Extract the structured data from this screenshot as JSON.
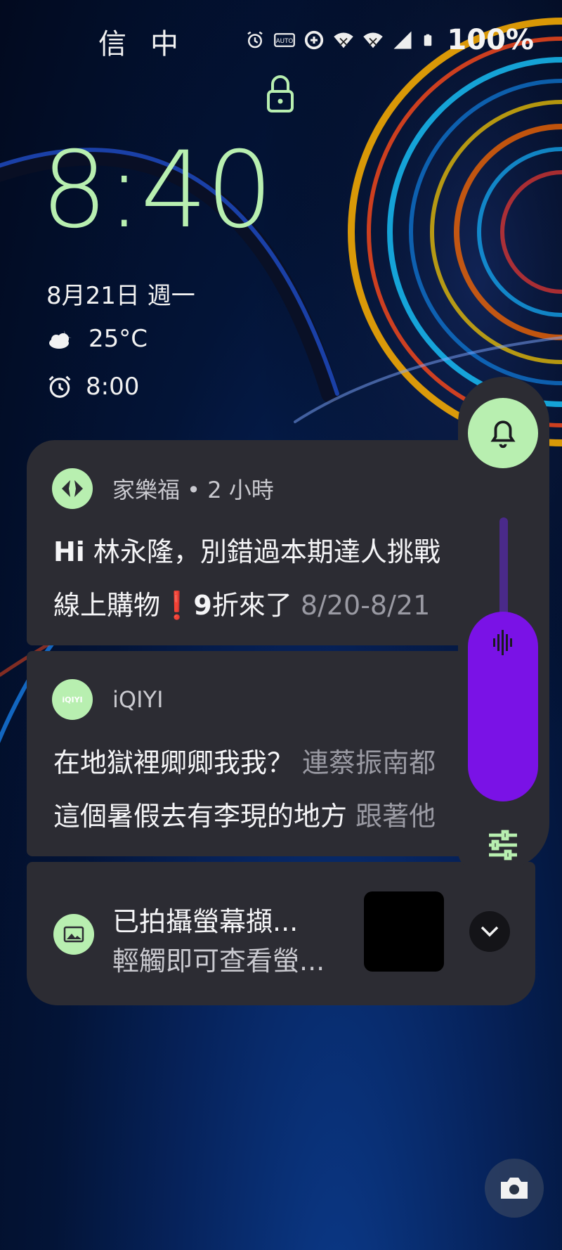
{
  "status_bar": {
    "carrier": "信中",
    "battery_percent": "100%",
    "icons": [
      "alarm-icon",
      "auto-hz-icon",
      "data-saver-icon",
      "wifi-icon",
      "wifi-icon-2",
      "signal-icon",
      "battery-icon"
    ]
  },
  "lockscreen": {
    "time": "8:40",
    "date": "8月21日 週一",
    "weather_temp": "25°C",
    "alarm_time": "8:00"
  },
  "notifications": [
    {
      "app_name": "家樂福 • 2 小時",
      "title_bold": "Hi",
      "title_rest": " 林永隆，別錯過本期達人挑戰",
      "text": "線上購物",
      "text_emoji": "❗",
      "text_bold": "9",
      "text_rest": "折來了 ",
      "text_muted": "8/20-8/21"
    },
    {
      "app_name": "iQIYI",
      "app_icon_label": "iQIYI",
      "title": "在地獄裡卿卿我我？",
      "title_muted": " 連蔡振南都",
      "text": "這個暑假去有李現的地方",
      "text_muted": " 跟著他"
    },
    {
      "title": "已拍攝螢幕擷...",
      "subtitle": "輕觸即可查看螢..."
    }
  ],
  "volume": {
    "level": 0.52,
    "accent": "#7a12e6",
    "ring_accent": "#b8efb0"
  },
  "colors": {
    "clock": "#b8efb0",
    "card_bg": "#2c2c33"
  }
}
